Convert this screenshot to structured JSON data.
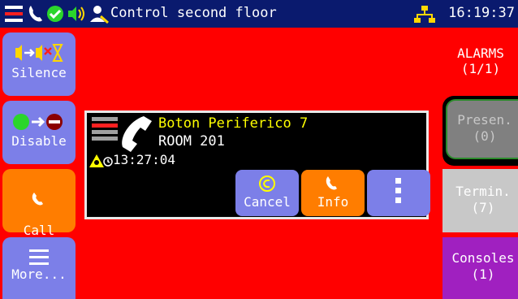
{
  "statusbar": {
    "title": "Control second floor",
    "time": "16:19:37"
  },
  "left_buttons": [
    {
      "label": "Silence"
    },
    {
      "label": "Disable"
    },
    {
      "label": "Call\nInfo"
    },
    {
      "label": "More..."
    }
  ],
  "call": {
    "name": "Boton Periferico 7",
    "room": "ROOM 201",
    "timestamp": "13:27:04",
    "actions": [
      {
        "label": "Cancel"
      },
      {
        "label": "Info"
      },
      {
        "label": ""
      }
    ]
  },
  "right_panel": {
    "alarms_label": "ALARMS",
    "alarms_count": "(1/1)",
    "tabs": [
      {
        "label": "Presen.",
        "count": "(0)"
      },
      {
        "label": "Termin.",
        "count": "(7)"
      },
      {
        "label": "Consoles",
        "count": "(1)"
      }
    ]
  },
  "colors": {
    "background": "#ff0000",
    "statusbar": "#0a1a6e",
    "button_blue": "#7c7fe8",
    "button_orange": "#ff7d00",
    "presence_tab": "#808080",
    "terminals_tab": "#c8c8c8",
    "consoles_tab": "#a020c0"
  },
  "icons": {
    "statusbar": [
      "menu-icon",
      "phone-icon",
      "check-icon",
      "speaker-icon",
      "user-alert-icon",
      "network-icon"
    ],
    "call": [
      "bed-icon",
      "phone-handset-icon",
      "alert-triangle-icon",
      "clock-icon"
    ]
  }
}
